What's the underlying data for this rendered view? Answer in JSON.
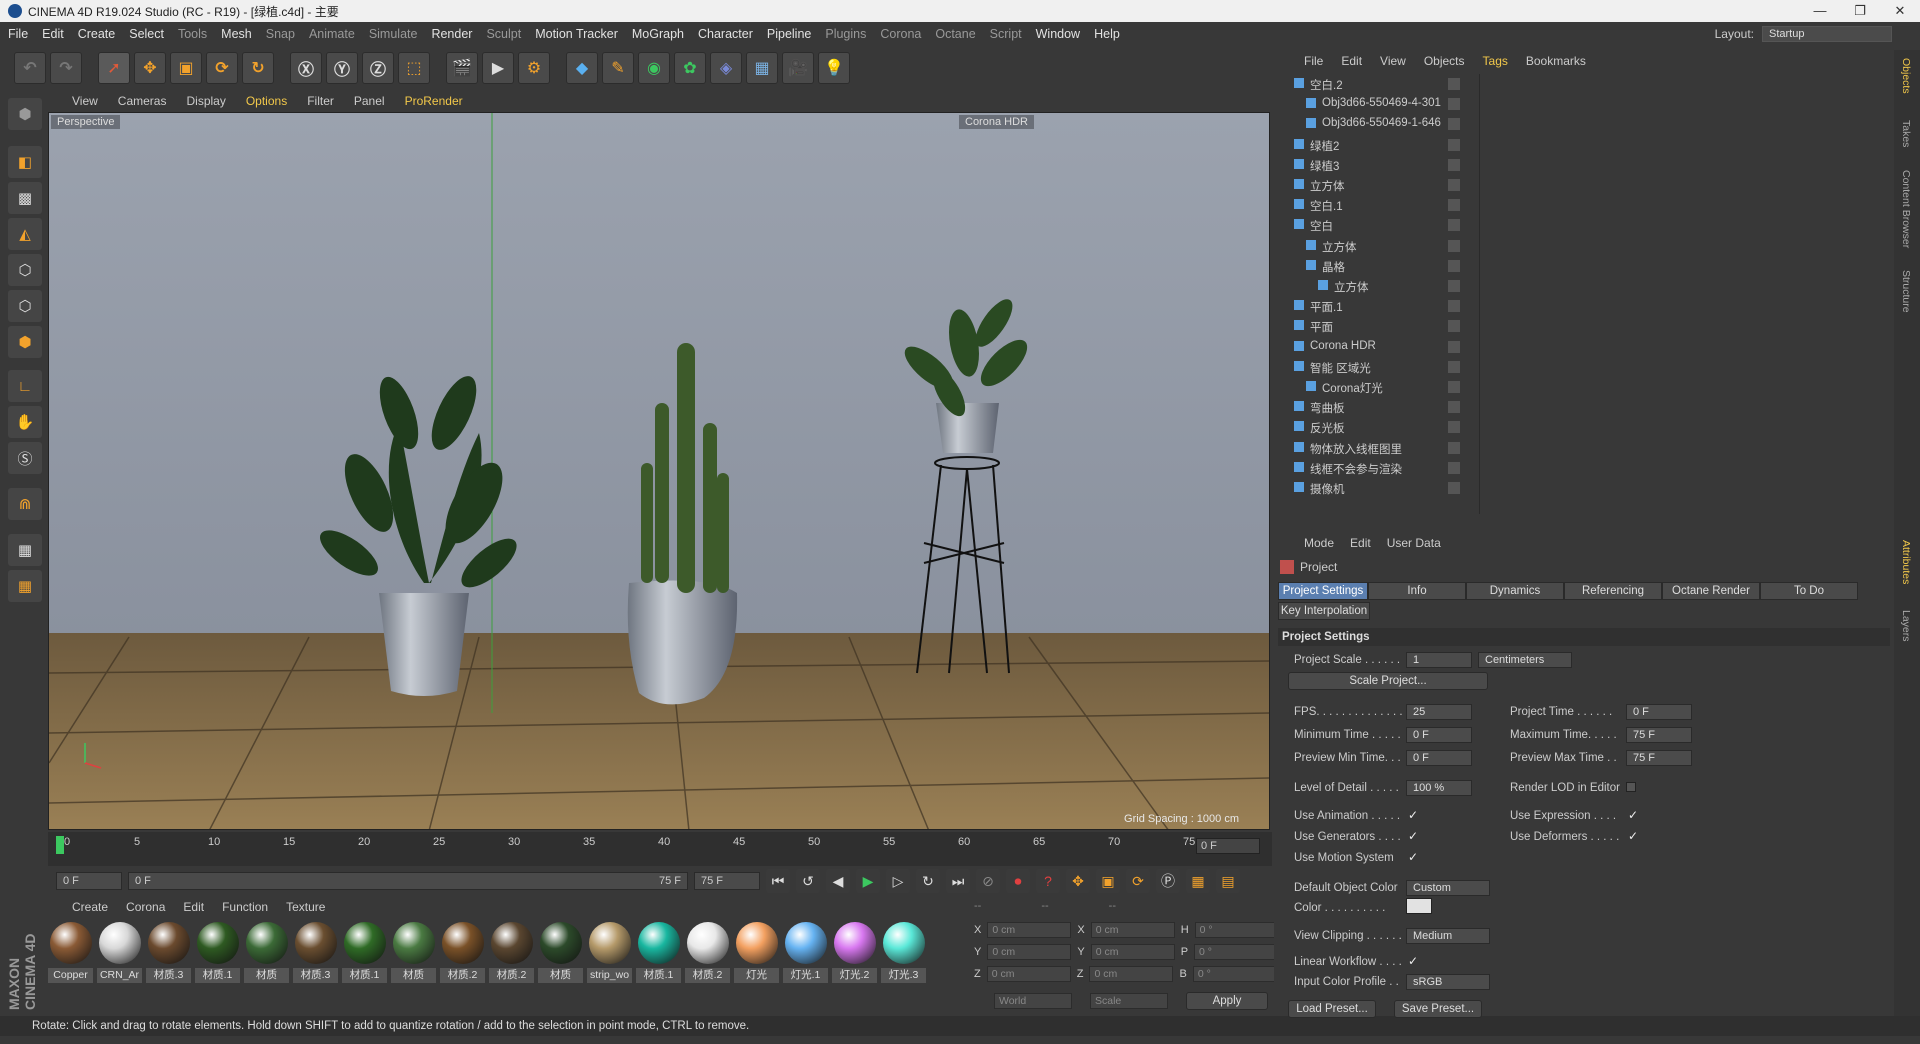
{
  "window": {
    "title": "CINEMA 4D R19.024 Studio (RC - R19) - [绿植.c4d] - 主要"
  },
  "menu": [
    "File",
    "Edit",
    "Create",
    "Select",
    "Tools",
    "Mesh",
    "Snap",
    "Animate",
    "Simulate",
    "Render",
    "Sculpt",
    "Motion Tracker",
    "MoGraph",
    "Character",
    "Pipeline",
    "Plugins",
    "Corona",
    "Octane",
    "Script",
    "Window",
    "Help"
  ],
  "layout": {
    "label": "Layout:",
    "value": "Startup"
  },
  "viewport": {
    "menu": [
      "View",
      "Cameras",
      "Display",
      "Options",
      "Filter",
      "Panel",
      "ProRender"
    ],
    "label": "Perspective",
    "hdr_badge": "Corona HDR",
    "grid_spacing": "Grid Spacing : 1000 cm"
  },
  "timeline": {
    "ticks": [
      "0",
      "5",
      "10",
      "15",
      "20",
      "25",
      "30",
      "35",
      "40",
      "45",
      "50",
      "55",
      "60",
      "65",
      "70",
      "75"
    ],
    "current_frame": "0 F",
    "start": "0 F",
    "range_start": "0 F",
    "range_end": "75 F",
    "end": "75 F"
  },
  "material_menu": [
    "Create",
    "Corona",
    "Edit",
    "Function",
    "Texture"
  ],
  "materials": [
    {
      "name": "Copper",
      "color": "#8a5a35"
    },
    {
      "name": "CRN_Ar",
      "color": "#d8d8d8"
    },
    {
      "name": "材质.3",
      "color": "#6b4a2e"
    },
    {
      "name": "材质.1",
      "color": "#2e5a22"
    },
    {
      "name": "材质",
      "color": "#3b6a36"
    },
    {
      "name": "材质.3",
      "color": "#6a4e30"
    },
    {
      "name": "材质.1",
      "color": "#2f6b26"
    },
    {
      "name": "材质",
      "color": "#4a7a42"
    },
    {
      "name": "材质.2",
      "color": "#7a5128"
    },
    {
      "name": "材质.2",
      "color": "#5a4630"
    },
    {
      "name": "材质",
      "color": "#2c4a2a"
    },
    {
      "name": "strip_wo",
      "color": "#b59a6a"
    },
    {
      "name": "材质.1",
      "color": "#19b7a0"
    },
    {
      "name": "材质.2",
      "color": "#e8e8e8"
    },
    {
      "name": "灯光",
      "color": "#f3a060"
    },
    {
      "name": "灯光.1",
      "color": "#66b3f2"
    },
    {
      "name": "灯光.2",
      "color": "#d878f0"
    },
    {
      "name": "灯光.3",
      "color": "#5ae8d8"
    }
  ],
  "coords": {
    "header": [
      "--",
      "--",
      "--"
    ],
    "rows": [
      {
        "a": "X",
        "av": "0 cm",
        "b": "X",
        "bv": "0 cm",
        "c": "H",
        "cv": "0 °"
      },
      {
        "a": "Y",
        "av": "0 cm",
        "b": "Y",
        "bv": "0 cm",
        "c": "P",
        "cv": "0 °"
      },
      {
        "a": "Z",
        "av": "0 cm",
        "b": "Z",
        "bv": "0 cm",
        "c": "B",
        "cv": "0 °"
      }
    ],
    "world": "World",
    "scale": "Scale",
    "apply": "Apply"
  },
  "objects": {
    "menu": [
      "File",
      "Edit",
      "View",
      "Objects",
      "Tags",
      "Bookmarks"
    ],
    "rows": [
      {
        "name": "空白.2",
        "indent": 0
      },
      {
        "name": "Obj3d66-550469-4-301",
        "indent": 1
      },
      {
        "name": "Obj3d66-550469-1-646",
        "indent": 1
      },
      {
        "name": "绿植2",
        "indent": 0
      },
      {
        "name": "绿植3",
        "indent": 0
      },
      {
        "name": "立方体",
        "indent": 0
      },
      {
        "name": "空白.1",
        "indent": 0
      },
      {
        "name": "空白",
        "indent": 0
      },
      {
        "name": "立方体",
        "indent": 1
      },
      {
        "name": "晶格",
        "indent": 1
      },
      {
        "name": "立方体",
        "indent": 2
      },
      {
        "name": "平面.1",
        "indent": 0
      },
      {
        "name": "平面",
        "indent": 0
      },
      {
        "name": "Corona HDR",
        "indent": 0
      },
      {
        "name": "智能 区域光",
        "indent": 0
      },
      {
        "name": "Corona灯光",
        "indent": 1
      },
      {
        "name": "弯曲板",
        "indent": 0
      },
      {
        "name": "反光板",
        "indent": 0
      },
      {
        "name": "物体放入线框图里",
        "indent": 0
      },
      {
        "name": "线框不会参与渲染",
        "indent": 0
      },
      {
        "name": "摄像机",
        "indent": 0
      }
    ]
  },
  "attributes": {
    "menu": [
      "Mode",
      "Edit",
      "User Data"
    ],
    "title": "Project",
    "tabs": [
      "Project Settings",
      "Info",
      "Dynamics",
      "Referencing",
      "Octane Render",
      "To Do"
    ],
    "tab2": "Key Interpolation",
    "section": "Project Settings",
    "project_scale_label": "Project Scale . . . . . .",
    "project_scale": "1",
    "units": "Centimeters",
    "scale_project_btn": "Scale Project...",
    "fps_label": "FPS. . . . . . . . . . . . . . .",
    "fps": "25",
    "project_time_label": "Project Time . . . . . .",
    "project_time": "0 F",
    "min_time_label": "Minimum Time . . . . .",
    "min_time": "0 F",
    "max_time_label": "Maximum Time. . . . .",
    "max_time": "75 F",
    "prev_min_label": "Preview Min Time. . .",
    "prev_min": "0 F",
    "prev_max_label": "Preview Max Time . .",
    "prev_max": "75 F",
    "lod_label": "Level of Detail . . . . .",
    "lod": "100 %",
    "render_lod_label": "Render LOD in Editor",
    "use_anim_label": "Use Animation . . . . .",
    "use_expr_label": "Use Expression . . . .",
    "use_gen_label": "Use Generators . . . .",
    "use_def_label": "Use Deformers . . . . .",
    "use_mb_label": "Use Motion System",
    "check": "✓",
    "def_obj_color_label": "Default Object Color",
    "def_obj_color": "Custom",
    "color_label": "Color . . . . . . . . . .",
    "view_clip_label": "View Clipping . . . . . .",
    "view_clip": "Medium",
    "linear_label": "Linear Workflow . . . .",
    "icp_label": "Input Color Profile . .",
    "icp": "sRGB",
    "load_preset": "Load Preset...",
    "save_preset": "Save Preset..."
  },
  "right_strip": [
    "Objects",
    "Takes",
    "Content Browser",
    "Structure",
    "Attributes",
    "Layers"
  ],
  "status": "Rotate: Click and drag to rotate elements. Hold down SHIFT to add to quantize rotation / add to the selection in point mode, CTRL to remove."
}
